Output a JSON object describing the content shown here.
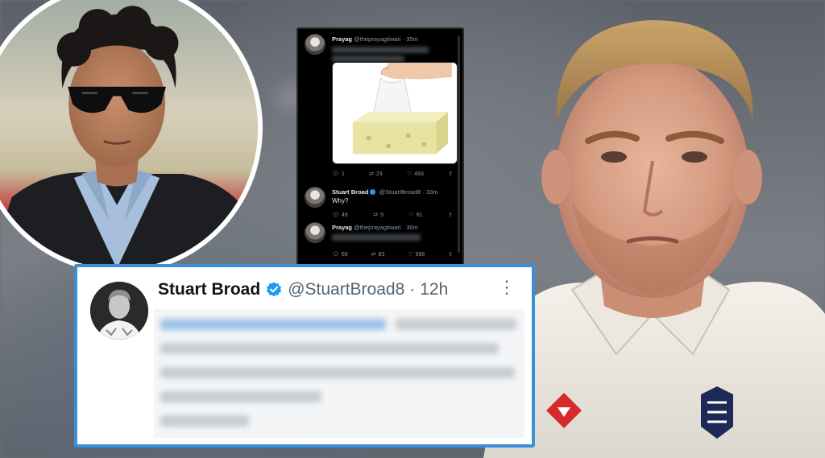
{
  "thread": {
    "tweet1": {
      "name": "Prayag",
      "handle": "@theprayagtiwari",
      "time": "· 35m",
      "replies": "1",
      "retweets": "23",
      "likes": "493"
    },
    "tweet2": {
      "name": "Stuart Broad",
      "handle": "@StuartBroad8",
      "time": "· 33m",
      "text": "Why?",
      "replies": "49",
      "retweets": "5",
      "likes": "61"
    },
    "tweet3": {
      "name": "Prayag",
      "handle": "@theprayagtiwari",
      "time": "· 30m",
      "replies": "66",
      "retweets": "83",
      "likes": "568"
    }
  },
  "card": {
    "name": "Stuart Broad",
    "handle": "@StuartBroad8",
    "separator": "·",
    "time": "12h",
    "more": "⋮"
  },
  "colors": {
    "card_border": "#3a8fd6",
    "verified": "#1d9bf0",
    "thread_bg": "#000000"
  },
  "icons": [
    "verified-badge-icon",
    "reply-icon",
    "retweet-icon",
    "like-icon",
    "share-icon",
    "more-options-icon"
  ]
}
